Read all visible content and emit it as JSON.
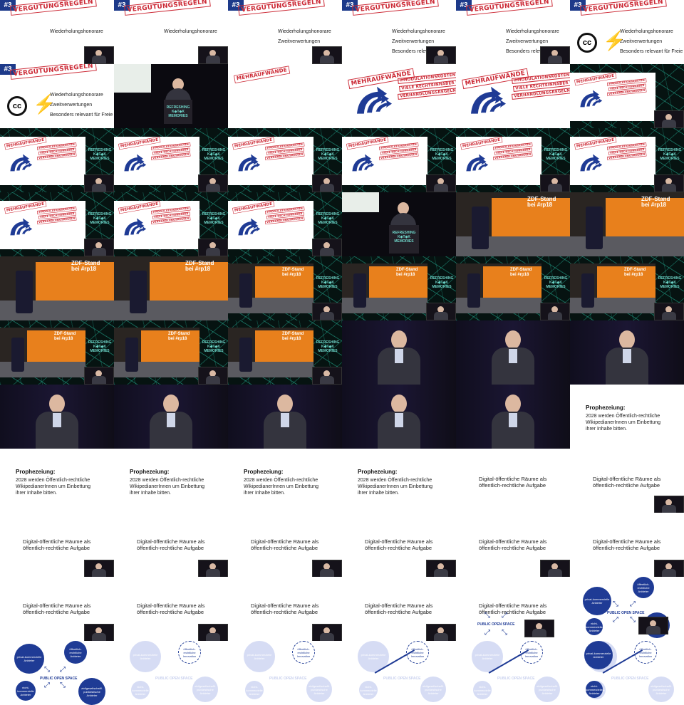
{
  "badge": "#3",
  "verguetung": {
    "stamp": "VERGÜTUNGSREGELN",
    "items": [
      "Wiederholungshonorare",
      "Zweitverwertungen",
      "Besonders relevant für Freie"
    ],
    "cc_label": "cc"
  },
  "mehraufwaende": {
    "stamp": "MEHRAUFWÄNDE",
    "items": [
      "#MODULATIONSKOSTEN",
      "VIELE RECHTEINHABER",
      "VERHANDLUNGSREGELN"
    ]
  },
  "stage": {
    "logo_line1": "REFRESHING",
    "logo_line2": "K◆T◆K",
    "logo_line3": "MEMORIES"
  },
  "zdf": {
    "line1": "ZDF-Stand",
    "line2": "bei #rp18"
  },
  "prophezeiung": {
    "title": "Prophezeiung:",
    "text": [
      "2028 werden Öffentlich-rechtliche",
      "WikipedianerInnen um Einbettung",
      "ihrer Inhalte bitten."
    ]
  },
  "digital": {
    "title": [
      "Digital-öffentliche Räume als",
      "öffentlich-rechtliche Aufgabe"
    ],
    "center": "PUBLIC OPEN SPACE",
    "circles": {
      "private": "privat-kommerzielle Anbieter",
      "oer": "öffentlich-rechtliche Anbieter",
      "nonprofit": "nicht-kommerzielle Anbieter",
      "civil": "zivilgesellschaftl. publizistische Anbieter",
      "innovation": "öffentlich-rechtliche Innovation"
    }
  },
  "colors": {
    "accent": "#1f3b95",
    "stamp": "#cc2a36",
    "zdf_orange": "#e8801c",
    "net": "#28c8aa"
  }
}
